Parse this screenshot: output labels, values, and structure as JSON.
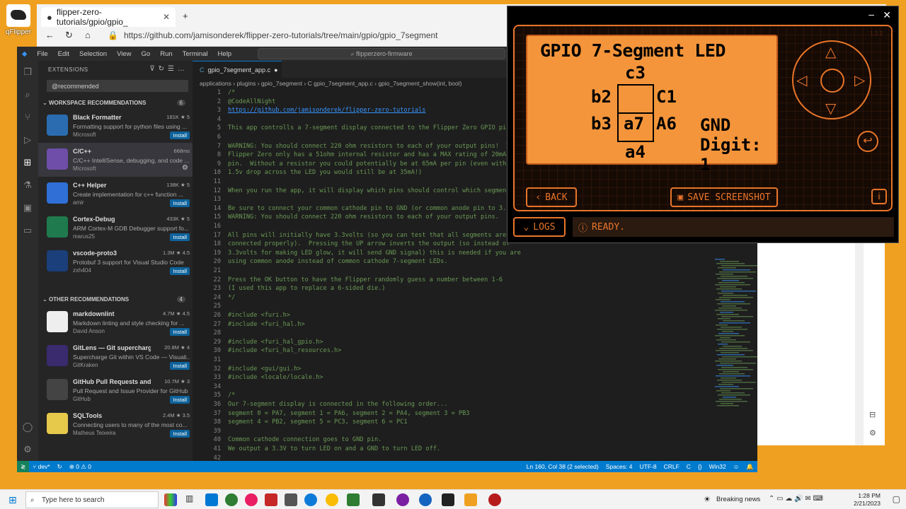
{
  "desktop": {
    "icon_label": "qFlipper"
  },
  "browser": {
    "tab_title": "flipper-zero-tutorials/gpio/gpio_",
    "url": "https://github.com/jamisonderek/flipper-zero-tutorials/tree/main/gpio/gpio_7segment"
  },
  "vscode": {
    "menu": [
      "File",
      "Edit",
      "Selection",
      "View",
      "Go",
      "Run",
      "Terminal",
      "Help"
    ],
    "command_center": "flipperzero-firmware",
    "sidebar": {
      "title": "EXTENSIONS",
      "search_value": "@recommended",
      "workspace_section": "WORKSPACE RECOMMENDATIONS",
      "workspace_count": "6",
      "other_section": "OTHER RECOMMENDATIONS",
      "other_count": "4",
      "extensions": [
        {
          "name": "Black Formatter",
          "desc": "Formatting support for python files using ...",
          "pub": "Microsoft",
          "stats": "181K ★ 5",
          "action": "Install",
          "color": "#2b6cb0"
        },
        {
          "name": "C/C++",
          "desc": "C/C++ IntelliSense, debugging, and code ...",
          "pub": "Microsoft",
          "stats": "668ms",
          "action": "⚙",
          "color": "#6e4ea8"
        },
        {
          "name": "C++ Helper",
          "desc": "Create implementation for c++ function ...",
          "pub": "amir",
          "stats": "138K ★ 5",
          "action": "Install",
          "color": "#2f6fd6"
        },
        {
          "name": "Cortex-Debug",
          "desc": "ARM Cortex-M GDB Debugger support fo...",
          "pub": "marus25",
          "stats": "433K ★ 5",
          "action": "Install",
          "color": "#1f7a4d"
        },
        {
          "name": "vscode-proto3",
          "desc": "Protobuf 3 support for Visual Studio Code",
          "pub": "zxh404",
          "stats": "1.3M ★ 4.5",
          "action": "Install",
          "color": "#1a3f7a"
        },
        {
          "name": "markdownlint",
          "desc": "Markdown linting and style checking for ...",
          "pub": "David Anson",
          "stats": "4.7M ★ 4.5",
          "action": "Install",
          "color": "#eeeeee"
        },
        {
          "name": "GitLens — Git supercharged",
          "desc": "Supercharge Git within VS Code — Visuali...",
          "pub": "GitKraken",
          "stats": "20.8M ★ 4",
          "action": "Install",
          "color": "#3a2a6e"
        },
        {
          "name": "GitHub Pull Requests and ...",
          "desc": "Pull Request and Issue Provider for GitHub",
          "pub": "GitHub",
          "stats": "10.7M ★ 3",
          "action": "Install",
          "color": "#444444"
        },
        {
          "name": "SQLTools",
          "desc": "Connecting users to many of the most co...",
          "pub": "Matheus Teixeira",
          "stats": "2.4M ★ 3.5",
          "action": "Install",
          "color": "#e6c84a"
        }
      ]
    },
    "editor": {
      "tab_label": "gpio_7segment_app.c",
      "breadcrumb": "applications › plugins › gpio_7segment › C gpio_7segment_app.c › gpio_7segment_show(int, bool)",
      "lines": [
        {
          "n": "1",
          "t": "/*"
        },
        {
          "n": "2",
          "t": "@CodeAllNight"
        },
        {
          "n": "3",
          "t": "https://github.com/jamisonderek/flipper-zero-tutorials",
          "link": true
        },
        {
          "n": "4",
          "t": ""
        },
        {
          "n": "5",
          "t": "This app controlls a 7-segment display connected to the Flipper Zero GPIO pin"
        },
        {
          "n": "6",
          "t": ""
        },
        {
          "n": "7",
          "t": "WARNING: You should connect 220 ohm resistors to each of your output pins!  T"
        },
        {
          "n": "8",
          "t": "Flipper Zero only has a 51ohm internal resistor and has a MAX rating of 20mA"
        },
        {
          "n": "9",
          "t": "pin.  Without a resistor you could potentially be at 65mA per pin (even with"
        },
        {
          "n": "10",
          "t": "1.5v drop across the LED you would still be at 35mA!)"
        },
        {
          "n": "11",
          "t": ""
        },
        {
          "n": "12",
          "t": "When you run the app, it will display which pins should control which segment"
        },
        {
          "n": "13",
          "t": ""
        },
        {
          "n": "14",
          "t": "Be sure to connect your common cathode pin to GND (or common anode pin to 3.3"
        },
        {
          "n": "15",
          "t": "WARNING: You should connect 220 ohm resistors to each of your output pins."
        },
        {
          "n": "16",
          "t": ""
        },
        {
          "n": "17",
          "t": "All pins will initially have 3.3volts (so you can test that all segments are"
        },
        {
          "n": "18",
          "t": "connected properly).  Pressing the UP arrow inverts the output (so instead of"
        },
        {
          "n": "19",
          "t": "3.3volts for making LED glow, it will send GND signal) this is needed if you are"
        },
        {
          "n": "20",
          "t": "using common anode instead of common cathode 7-segment LEDs."
        },
        {
          "n": "21",
          "t": ""
        },
        {
          "n": "22",
          "t": "Press the OK button to have the Flipper randomly guess a number between 1-6"
        },
        {
          "n": "23",
          "t": "(I used this app to replace a 6-sided die.)"
        },
        {
          "n": "24",
          "t": "*/"
        },
        {
          "n": "25",
          "t": ""
        },
        {
          "n": "26",
          "t": "#include <furi.h>"
        },
        {
          "n": "27",
          "t": "#include <furi_hal.h>"
        },
        {
          "n": "28",
          "t": ""
        },
        {
          "n": "29",
          "t": "#include <furi_hal_gpio.h>"
        },
        {
          "n": "30",
          "t": "#include <furi_hal_resources.h>"
        },
        {
          "n": "31",
          "t": ""
        },
        {
          "n": "32",
          "t": "#include <gui/gui.h>"
        },
        {
          "n": "33",
          "t": "#include <locale/locale.h>"
        },
        {
          "n": "34",
          "t": ""
        },
        {
          "n": "35",
          "t": "/*"
        },
        {
          "n": "36",
          "t": "Our 7-segment display is connected in the following order..."
        },
        {
          "n": "37",
          "t": "segment 0 = PA7, segment 1 = PA6, segment 2 = PA4, segment 3 = PB3"
        },
        {
          "n": "38",
          "t": "segment 4 = PB2, segment 5 = PC3, segment 6 = PC1"
        },
        {
          "n": "39",
          "t": ""
        },
        {
          "n": "40",
          "t": "Common cathode connection goes to GND pin."
        },
        {
          "n": "41",
          "t": "We output a 3.3V to turn LED on and a GND to turn LED off."
        },
        {
          "n": "42",
          "t": ""
        }
      ]
    },
    "status": {
      "branch": "dev*",
      "problems": "⊗ 0 ⚠ 0",
      "position": "Ln 160, Col 38 (2 selected)",
      "spaces": "Spaces: 4",
      "encoding": "UTF-8",
      "eol": "CRLF",
      "lang": "C",
      "platform": "Win32"
    }
  },
  "qflipper": {
    "version": "1.2.2",
    "screen": {
      "title": "GPIO 7-Segment LED",
      "c3": "c3",
      "b2": "b2",
      "c1": "C1",
      "b3": "b3",
      "a7": "a7",
      "a6": "A6",
      "a4": "a4",
      "gnd": "GND",
      "digit": "Digit: 1"
    },
    "back_label": "BACK",
    "save_label": "SAVE SCREENSHOT",
    "logs_label": "LOGS",
    "status_label": "READY."
  },
  "taskbar": {
    "search_placeholder": "Type here to search",
    "news": "Breaking news",
    "time": "1:28 PM",
    "date": "2/21/2023"
  }
}
